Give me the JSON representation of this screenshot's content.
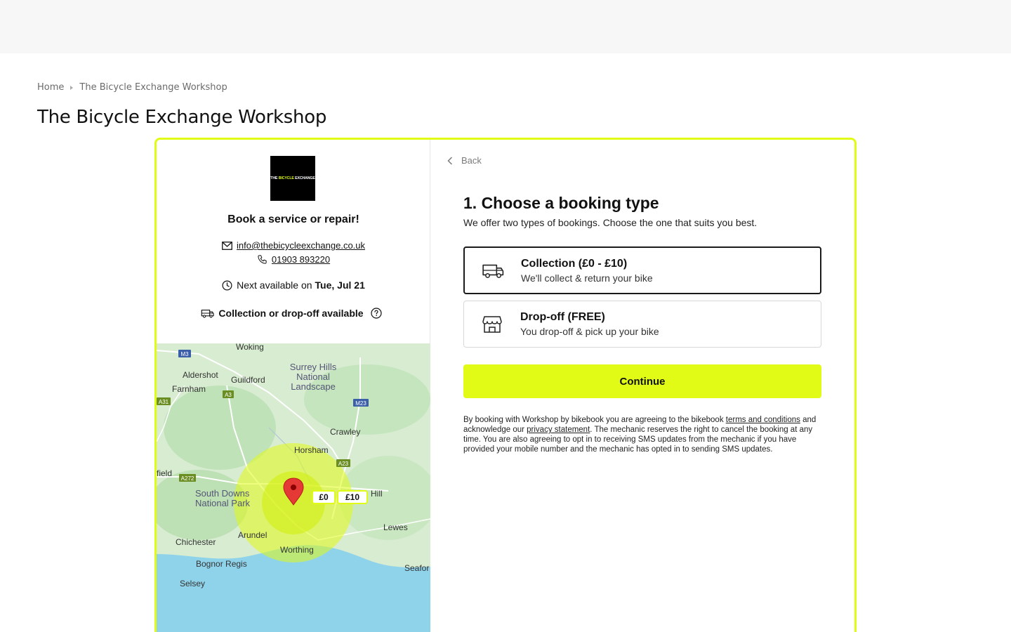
{
  "breadcrumb": {
    "home": "Home",
    "current": "The Bicycle Exchange Workshop"
  },
  "page_title": "The Bicycle Exchange Workshop",
  "shop": {
    "logo_text_a": "THE ",
    "logo_text_b": "BICYCLE",
    "logo_text_c": " EXCHANGE",
    "heading": "Book a service or repair!",
    "email": "info@thebicycleexchange.co.uk",
    "phone": "01903 893220",
    "next_available_label": "Next available on",
    "next_available_date": "Tue, Jul 21",
    "collection_text": "Collection or drop-off available"
  },
  "map": {
    "labels": {
      "woking": "Woking",
      "aldershot": "Aldershot",
      "guildford": "Guildford",
      "farnham": "Farnham",
      "surrey1": "Surrey Hills",
      "surrey2": "National",
      "surrey3": "Landscape",
      "crawley": "Crawley",
      "horsham": "Horsham",
      "field": "field",
      "southdowns1": "South Downs",
      "southdowns2": "National Park",
      "hill": "Hill",
      "lewes": "Lewes",
      "arundel": "Arundel",
      "chichester": "Chichester",
      "worthing": "Worthing",
      "bognor": "Bognor Regis",
      "selsey": "Selsey",
      "seaford": "Seafor"
    },
    "roads": {
      "m3": "M3",
      "a3": "A3",
      "a31": "A31",
      "m23": "M23",
      "a23": "A23",
      "a272": "A272"
    },
    "price_inner": "£0",
    "price_outer": "£10"
  },
  "booking": {
    "back_label": "Back",
    "step_title": "1. Choose a booking type",
    "step_subtitle": "We offer two types of bookings. Choose the one that suits you best.",
    "options": [
      {
        "title": "Collection (£0 - £10)",
        "subtitle": "We'll collect & return your bike",
        "selected": true
      },
      {
        "title": "Drop-off (FREE)",
        "subtitle": "You drop-off & pick up your bike",
        "selected": false
      }
    ],
    "continue_label": "Continue",
    "legal": {
      "part1": "By booking with Workshop by bikebook you are agreeing to the bikebook ",
      "terms_link": "terms and conditions",
      "part2": " and acknowledge our ",
      "privacy_link": "privacy statement",
      "part3": ". The mechanic reserves the right to cancel the booking at any time. You are also agreeing to opt in to receiving SMS updates from the mechanic if you have provided your mobile number and the mechanic has opted in to sending SMS updates."
    }
  },
  "colors": {
    "accent": "#e1fb16",
    "selected_border": "#1a1a1a",
    "map_land": "#c8e6c4",
    "map_sea": "#8fd3ea",
    "pin": "#e53935"
  }
}
